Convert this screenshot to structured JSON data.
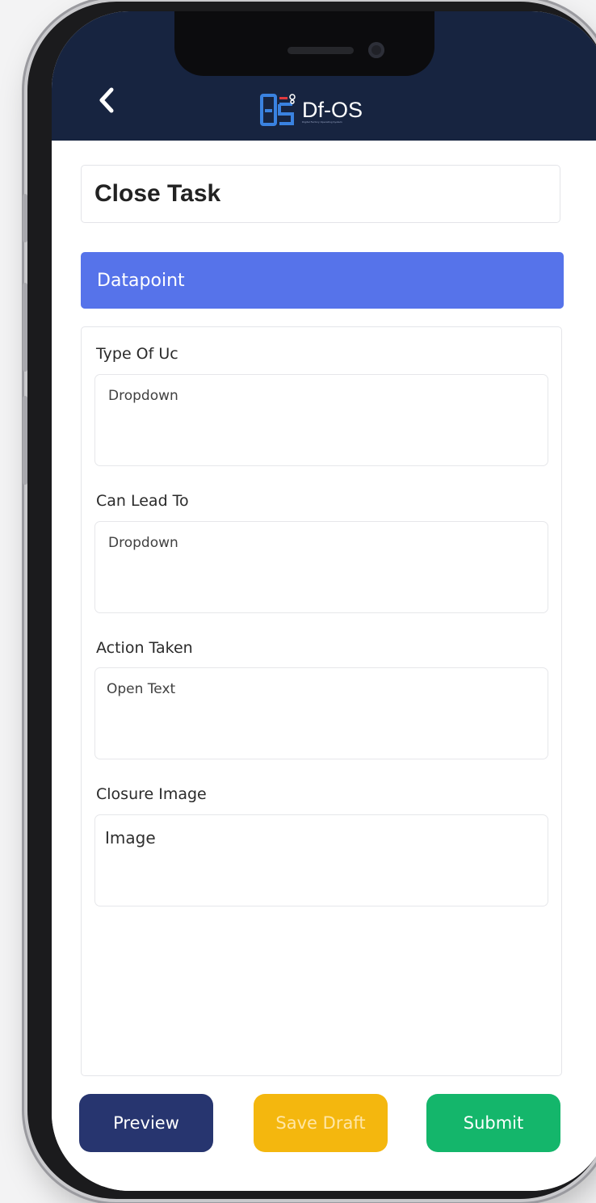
{
  "header": {
    "logo_text": "Df-OS",
    "logo_subtitle": "Digital Factory Operating System"
  },
  "page": {
    "title": "Close Task"
  },
  "section": {
    "title": "Datapoint"
  },
  "fields": [
    {
      "label": "Type Of Uc",
      "value": "Dropdown"
    },
    {
      "label": "Can Lead To",
      "value": "Dropdown"
    },
    {
      "label": "Action Taken",
      "value": "Open Text"
    },
    {
      "label": "Closure Image",
      "value": "Image"
    }
  ],
  "actions": {
    "preview_label": "Preview",
    "save_draft_label": "Save Draft",
    "submit_label": "Submit"
  },
  "colors": {
    "appbar": "#172440",
    "section_accent": "#5673ea",
    "preview": "#27356f",
    "save_draft": "#f4b70e",
    "submit": "#14b66b"
  },
  "icons": [
    "back-chevron-icon",
    "dfos-logo-icon"
  ]
}
